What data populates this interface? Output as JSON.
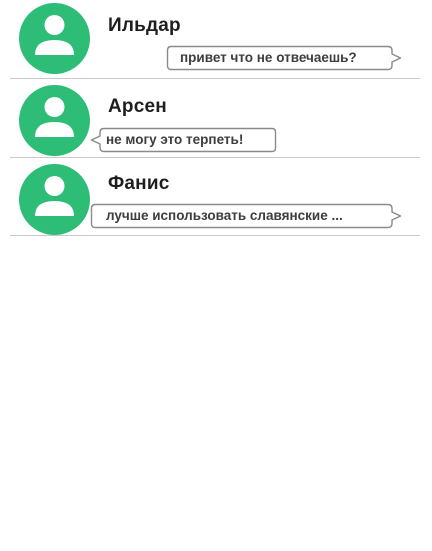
{
  "icons": {
    "avatar": "person-avatar-icon"
  },
  "colors": {
    "avatar_bg": "#2ebd77",
    "avatar_figure": "#ffffff",
    "divider": "#c9c9c9",
    "bubble_border": "#8a8a8a",
    "text": "#1e1e1e"
  },
  "chats": [
    {
      "name": "Ильдар",
      "message": "привет что не отвечаешь?",
      "direction": "outgoing"
    },
    {
      "name": "Арсен",
      "message": "не могу это терпеть!",
      "direction": "incoming"
    },
    {
      "name": "Фанис",
      "message": "лучше использовать славянские ...",
      "direction": "outgoing"
    }
  ]
}
